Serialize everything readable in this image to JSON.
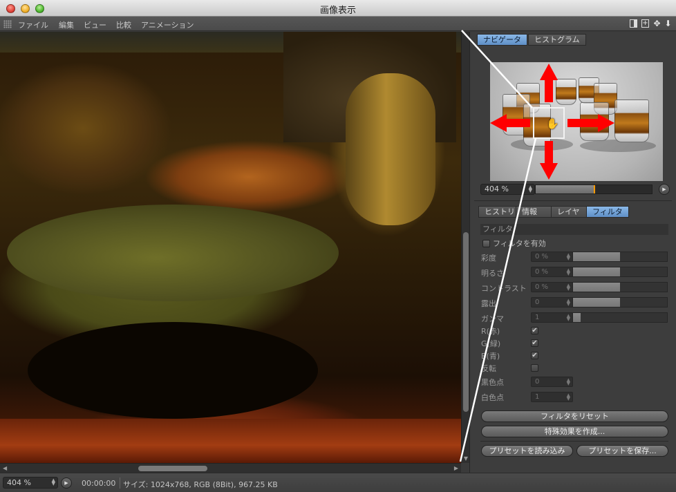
{
  "window": {
    "title": "画像表示"
  },
  "menubar": {
    "items": [
      "ファイル",
      "編集",
      "ビュー",
      "比較",
      "アニメーション"
    ]
  },
  "statusbar": {
    "zoom": "404 %",
    "timecode": "00:00:00",
    "info": "サイズ: 1024x768, RGB (8Bit), 967.25 KB"
  },
  "navigator": {
    "tabs": [
      "ナビゲータ",
      "ヒストグラム"
    ],
    "active_tab": "ナビゲータ",
    "zoom": "404 %",
    "zoom_slider_fraction": 0.5
  },
  "filter_panel": {
    "tabs": [
      "ヒストリ",
      "情報",
      "レイヤ",
      "フィルタ"
    ],
    "active_tab": "フィルタ",
    "section_title": "フィルタ",
    "enable_label": "フィルタを有効",
    "params": [
      {
        "label": "彩度",
        "value": "0 %",
        "slider_fraction": 0.5
      },
      {
        "label": "明るさ",
        "value": "0 %",
        "slider_fraction": 0.5
      },
      {
        "label": "コントラスト",
        "value": "0 %",
        "slider_fraction": 0.5
      },
      {
        "label": "露出",
        "value": "0",
        "slider_fraction": 0.5
      },
      {
        "label": "ガンマ",
        "value": "1",
        "slider_fraction": 0.08
      }
    ],
    "channels": [
      {
        "label": "R(赤)",
        "checked": true
      },
      {
        "label": "G(緑)",
        "checked": true
      },
      {
        "label": "B(青)",
        "checked": true
      },
      {
        "label": "反転",
        "checked": false
      }
    ],
    "points": [
      {
        "label": "黒色点",
        "value": "0"
      },
      {
        "label": "白色点",
        "value": "1"
      }
    ],
    "buttons": {
      "reset": "フィルタをリセット",
      "create_effect": "特殊効果を作成...",
      "load_preset": "プリセットを読み込み",
      "save_preset": "プリセットを保存..."
    }
  },
  "colors": {
    "accent_tab": "#6f9fd6",
    "arrow": "#ff0000",
    "slider_marker": "#ff9a00"
  }
}
